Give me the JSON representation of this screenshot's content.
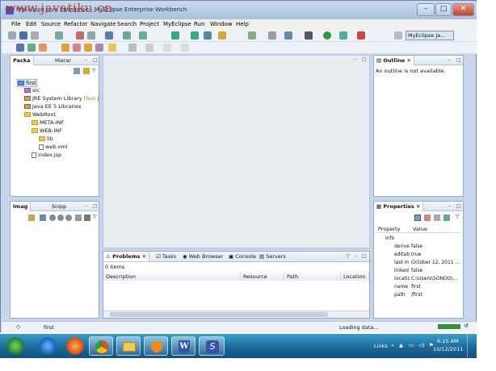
{
  "watermark": "www.javatiku.cn",
  "window": {
    "title": "MyEclipse Java Enterprise - MyEclipse Enterprise Workbench"
  },
  "window_buttons": {
    "minimize": "–",
    "maximize": "□",
    "close": "✕"
  },
  "menu": [
    "File",
    "Edit",
    "Source",
    "Refactor",
    "Navigate",
    "Search",
    "Project",
    "MyEclipse",
    "Run",
    "Window",
    "Help"
  ],
  "perspective": {
    "label": "MyEclipse Ja..."
  },
  "left_top_pane": {
    "tabs": [
      "Packa",
      "Hierar"
    ],
    "tree": [
      {
        "label": "first",
        "icon": "project-icon",
        "depth": 0,
        "selected": true
      },
      {
        "label": "src",
        "icon": "package-icon",
        "depth": 1
      },
      {
        "label": "JRE System Library",
        "suffix": "[Sun J",
        "icon": "jar-icon",
        "depth": 1
      },
      {
        "label": "Java EE 5 Libraries",
        "icon": "jar-icon",
        "depth": 1
      },
      {
        "label": "WebRoot",
        "icon": "folder-icon",
        "depth": 1
      },
      {
        "label": "META-INF",
        "icon": "folder-icon",
        "depth": 2
      },
      {
        "label": "WEB-INF",
        "icon": "folder-icon",
        "depth": 2
      },
      {
        "label": "lib",
        "icon": "folder-icon",
        "depth": 3
      },
      {
        "label": "web.xml",
        "icon": "file-icon",
        "depth": 3
      },
      {
        "label": "index.jsp",
        "icon": "file-icon",
        "depth": 2
      }
    ]
  },
  "left_bottom_pane": {
    "tabs": [
      "Imag",
      "Snipp"
    ]
  },
  "outline_pane": {
    "tab": "Outline",
    "message": "An outline is not available."
  },
  "properties_pane": {
    "tab": "Properties",
    "headers": [
      "Property",
      "Value"
    ],
    "group": "Info",
    "rows": [
      {
        "k": "derive",
        "v": "false"
      },
      {
        "k": "editab",
        "v": "true"
      },
      {
        "k": "last m",
        "v": "October 12, 2011 ..."
      },
      {
        "k": "linked",
        "v": "false"
      },
      {
        "k": "locatic",
        "v": "C:\\Users\\SONOO\\..."
      },
      {
        "k": "name",
        "v": "first"
      },
      {
        "k": "path",
        "v": "/first"
      }
    ]
  },
  "bottom_pane": {
    "tabs": [
      "Problems",
      "Tasks",
      "Web Browser",
      "Console",
      "Servers"
    ],
    "count": "0 items",
    "columns": [
      "Description",
      "Resource",
      "Path",
      "Location"
    ]
  },
  "status": {
    "left": "first",
    "right": "Loading data..."
  },
  "taskbar": {
    "links": "Links",
    "time": "6:15 AM",
    "date": "10/12/2011",
    "apps": [
      "start-orb-icon",
      "ie-icon",
      "firefox-icon",
      "chrome-icon",
      "explorer-icon",
      "media-player-icon",
      "word-icon",
      "myeclipse-icon"
    ]
  }
}
